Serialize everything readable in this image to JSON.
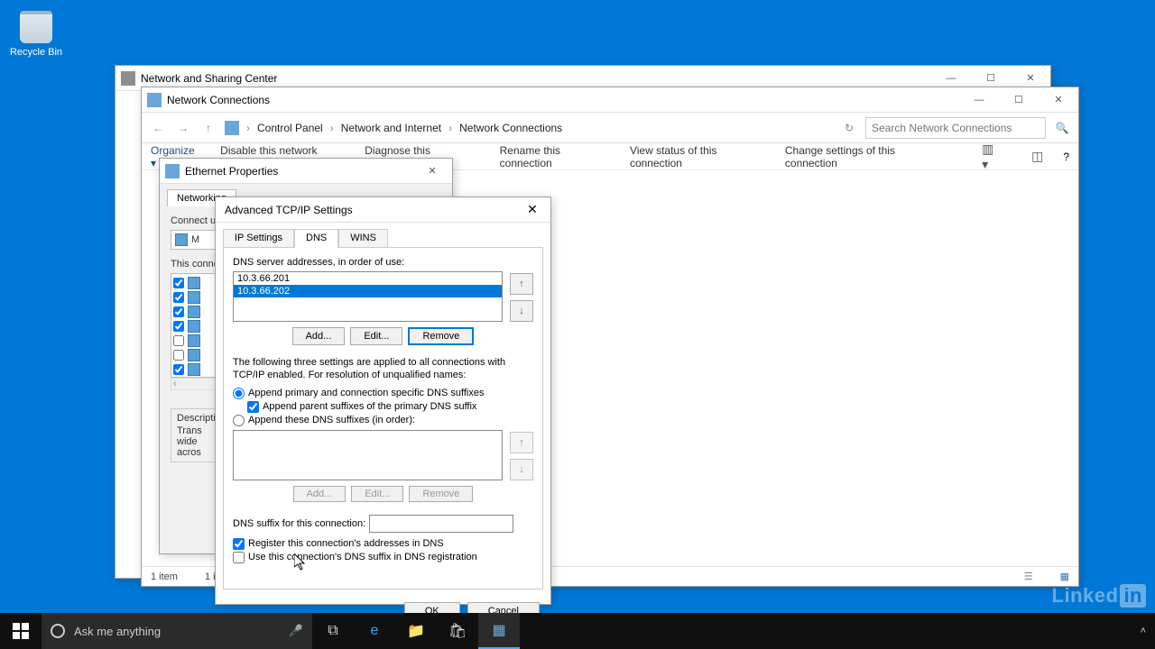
{
  "desktop": {
    "recycle_bin": "Recycle Bin"
  },
  "win1": {
    "title": "Network and Sharing Center"
  },
  "win2": {
    "title": "Network Connections",
    "breadcrumbs": [
      "Control Panel",
      "Network and Internet",
      "Network Connections"
    ],
    "search_placeholder": "Search Network Connections",
    "toolbar": {
      "organize": "Organize",
      "disable": "Disable this network device",
      "diagnose": "Diagnose this connection",
      "rename": "Rename this connection",
      "view_status": "View status of this connection",
      "change_settings": "Change settings of this connection"
    },
    "status_left": "1 item",
    "status_sel": "1 item"
  },
  "win3": {
    "title": "Ethernet Properties",
    "tab": "Networking",
    "connect_label": "Connect using:",
    "items_label": "This connection uses the following items:",
    "desc_label": "Description",
    "desc": "Transmission Control Protocol/Internet Protocol. The default wide area network protocol that provides communication across diverse interconnected networks."
  },
  "win4": {
    "title": "Advanced TCP/IP Settings",
    "tabs": {
      "ip": "IP Settings",
      "dns": "DNS",
      "wins": "WINS"
    },
    "dns_label": "DNS server addresses, in order of use:",
    "dns_servers": [
      "10.3.66.201",
      "10.3.66.202"
    ],
    "buttons": {
      "add": "Add...",
      "edit": "Edit...",
      "remove": "Remove"
    },
    "explain": "The following three settings are applied to all connections with TCP/IP enabled. For resolution of unqualified names:",
    "radio1": "Append primary and connection specific DNS suffixes",
    "check_parent": "Append parent suffixes of the primary DNS suffix",
    "radio2": "Append these DNS suffixes (in order):",
    "suffix_label": "DNS suffix for this connection:",
    "check_register": "Register this connection's addresses in DNS",
    "check_use_suffix": "Use this connection's DNS suffix in DNS registration",
    "ok": "OK",
    "cancel": "Cancel"
  },
  "taskbar": {
    "search_placeholder": "Ask me anything"
  },
  "brand": {
    "linked": "Linked",
    "in": "in"
  }
}
